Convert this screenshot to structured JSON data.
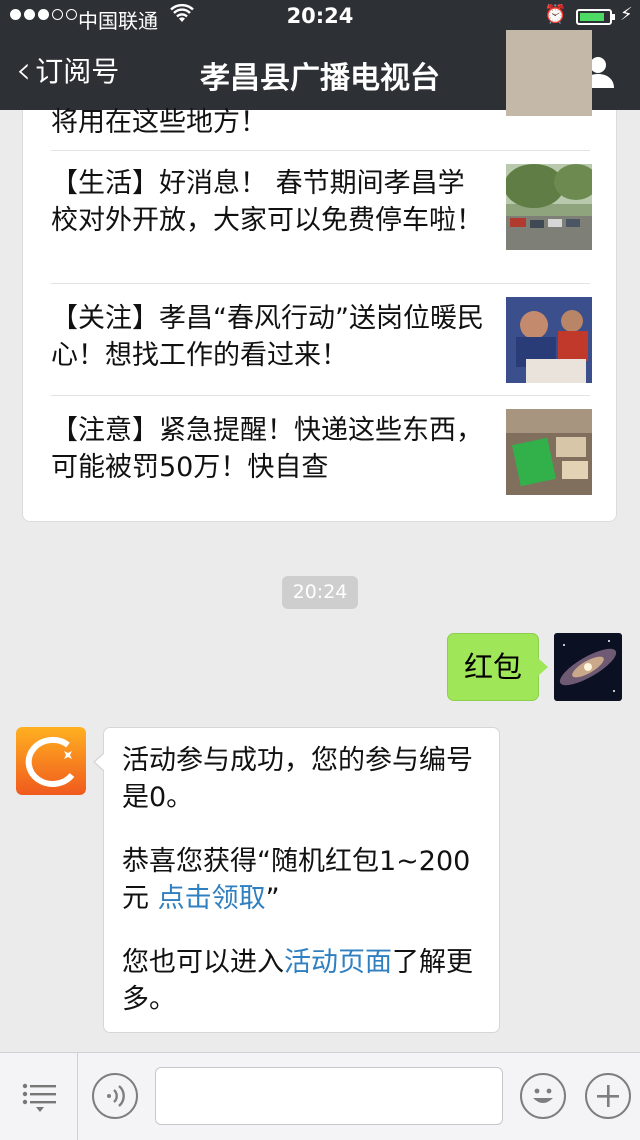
{
  "status_bar": {
    "carrier": "中国联通",
    "time": "20:24",
    "battery_level": 0.85,
    "signal_bars": 3,
    "icons": [
      "wifi-icon",
      "alarm-icon",
      "battery-icon",
      "charging-icon"
    ]
  },
  "nav": {
    "back_label": "订阅号",
    "title": "孝昌县广播电视台",
    "icons": [
      "chevron-left-icon",
      "user-profile-icon"
    ]
  },
  "articles": [
    {
      "text": "将用在这些地方！"
    },
    {
      "text": "【生活】好消息！ 春节期间孝昌学校对外开放，大家可以免费停车啦！"
    },
    {
      "text": "【关注】孝昌“春风行动”送岗位暖民心！想找工作的看过来！"
    },
    {
      "text": "【注意】紧急提醒！快递这些东西，可能被罚50万！快自查"
    }
  ],
  "chat": {
    "timestamp": "20:24",
    "sent_message": "红包",
    "reply": {
      "p1": "活动参与成功，您的参与编号是0。",
      "p2_prefix": "恭喜您获得“随机红包1~200元 ",
      "p2_link": "点击领取",
      "p2_suffix": "”",
      "p3_prefix": "您也可以进入",
      "p3_link": "活动页面",
      "p3_suffix": "了解更多。"
    }
  },
  "input_bar": {
    "placeholder": "",
    "icons": [
      "menu-list-icon",
      "voice-icon",
      "emoji-icon",
      "plus-icon"
    ]
  },
  "colors": {
    "nav_bg": "#2d3034",
    "sent_bubble": "#9fe658",
    "link": "#2f7fc1",
    "background": "#ebebeb"
  }
}
